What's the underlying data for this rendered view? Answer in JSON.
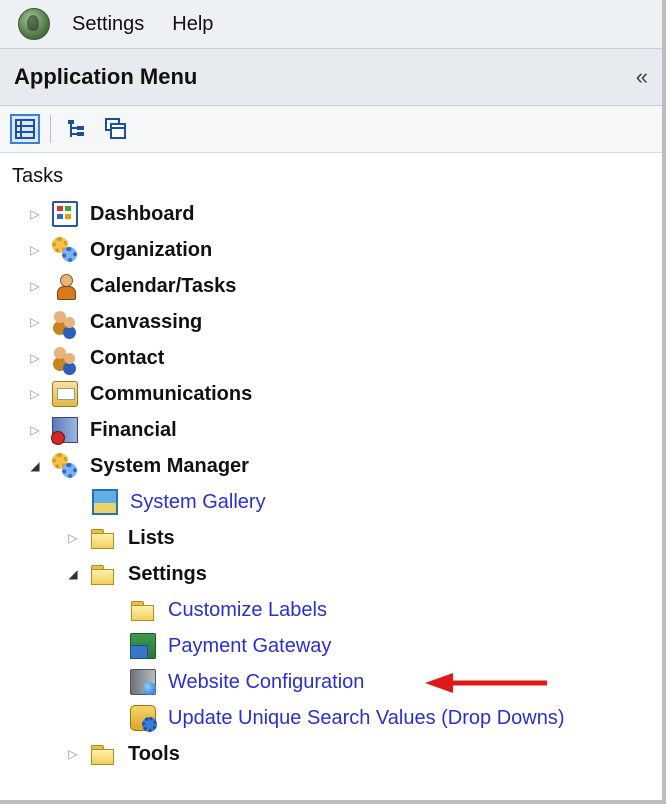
{
  "menubar": {
    "items": [
      "Settings",
      "Help"
    ]
  },
  "panel": {
    "title": "Application Menu",
    "collapse_label": "«"
  },
  "section": {
    "label": "Tasks"
  },
  "tree": {
    "dashboard": "Dashboard",
    "organization": "Organization",
    "calendar_tasks": "Calendar/Tasks",
    "canvassing": "Canvassing",
    "contact": "Contact",
    "communications": "Communications",
    "financial": "Financial",
    "system_manager": "System Manager",
    "system_gallery": "System Gallery",
    "lists": "Lists",
    "settings": "Settings",
    "customize_labels": "Customize Labels",
    "payment_gateway": "Payment Gateway",
    "website_configuration": "Website Configuration",
    "update_unique_search_values": "Update Unique Search Values (Drop Downs)",
    "tools": "Tools"
  },
  "colors": {
    "link": "#2a2fd0",
    "annotation_arrow": "#e01818",
    "toolbar_active": "#3c7ed3"
  }
}
